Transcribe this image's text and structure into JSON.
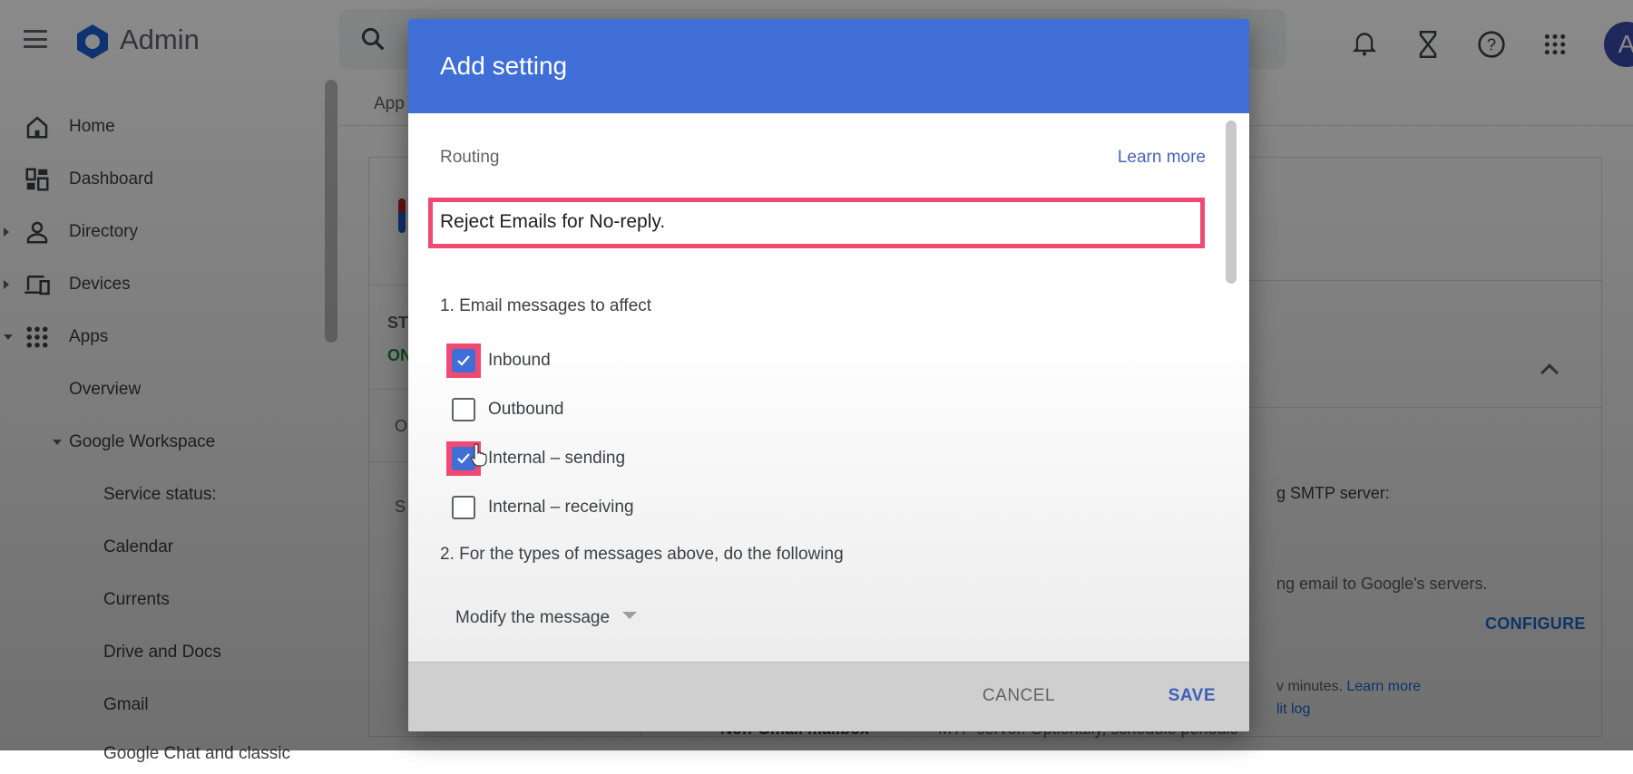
{
  "app": {
    "brand": "Admin",
    "avatar_initial": "A"
  },
  "topbar": {
    "icons": [
      "search-icon",
      "notifications-icon",
      "hourglass-icon",
      "help-icon",
      "apps-grid-icon"
    ]
  },
  "sidebar": {
    "items": [
      {
        "label": "Home",
        "icon": "home-icon"
      },
      {
        "label": "Dashboard",
        "icon": "dashboard-icon"
      },
      {
        "label": "Directory",
        "icon": "person-icon"
      },
      {
        "label": "Devices",
        "icon": "devices-icon"
      },
      {
        "label": "Apps",
        "icon": "apps-icon"
      },
      {
        "label": "Overview"
      },
      {
        "label": "Google Workspace"
      },
      {
        "label": "Service status:"
      },
      {
        "label": "Calendar"
      },
      {
        "label": "Currents"
      },
      {
        "label": "Drive and Docs"
      },
      {
        "label": "Gmail"
      },
      {
        "label": "Google Chat and classic"
      }
    ]
  },
  "main": {
    "breadcrumb": "App",
    "status_label": "ST",
    "status_value": "ON",
    "left_row_1": "O",
    "left_row_2": "S",
    "smtp_text": "g SMTP server:",
    "servers_text": "ng email to Google's servers.",
    "configure_label": "CONFIGURE",
    "minutes_text": "v minutes.",
    "learn_more": "Learn more",
    "audit_log": "lit log",
    "bottom_label": "Non-Gmail mailbox",
    "bottom_text": "MTP server. Optionally, schedule periodic"
  },
  "dialog": {
    "title": "Add setting",
    "section": "Routing",
    "learn_more": "Learn more",
    "name_value": "Reject Emails for No-reply.",
    "step1": "1. Email messages to affect",
    "checkboxes": [
      {
        "label": "Inbound",
        "checked": true
      },
      {
        "label": "Outbound",
        "checked": false
      },
      {
        "label": "Internal – sending",
        "checked": true
      },
      {
        "label": "Internal – receiving",
        "checked": false
      }
    ],
    "step2": "2. For the types of messages above, do the following",
    "action_select": "Modify the message",
    "cancel_label": "CANCEL",
    "save_label": "SAVE"
  },
  "colors": {
    "accent": "#3f6ed6",
    "highlight": "#ef4b72",
    "link": "#4a63b8"
  }
}
